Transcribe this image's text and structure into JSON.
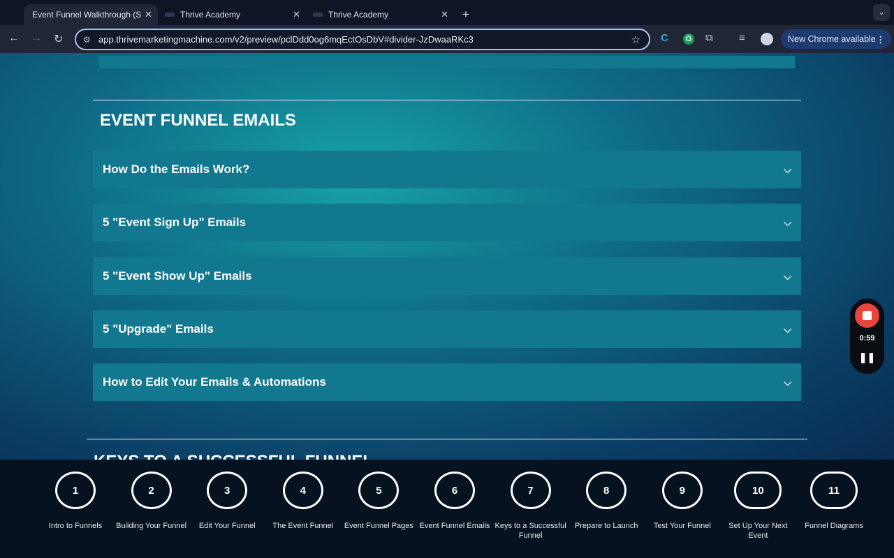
{
  "browser": {
    "tabs": [
      {
        "title": "Event Funnel Walkthrough (S",
        "active": true
      },
      {
        "title": "Thrive Academy"
      },
      {
        "title": "Thrive Academy"
      }
    ],
    "new_tab": "+",
    "url": "app.thrivemarketingmachine.com/v2/preview/pclDdd0og6mqEctOsDbV#divider-JzDwaaRKc3",
    "update_label": "New Chrome available"
  },
  "page": {
    "section_title": "EVENT FUNNEL EMAILS",
    "accordion": [
      {
        "label": "How Do the Emails Work?"
      },
      {
        "label": "5 \"Event Sign Up\" Emails"
      },
      {
        "label": "5 \"Event Show Up\" Emails"
      },
      {
        "label": "5 \"Upgrade\" Emails"
      },
      {
        "label": "How to Edit Your Emails & Automations"
      }
    ],
    "next_section_title": "KEYS TO A SUCCESSFUL FUNNEL"
  },
  "steps": [
    {
      "num": "1",
      "label": "Intro to Funnels"
    },
    {
      "num": "2",
      "label": "Building Your Funnel"
    },
    {
      "num": "3",
      "label": "Edit Your Funnel"
    },
    {
      "num": "4",
      "label": "The Event Funnel"
    },
    {
      "num": "5",
      "label": "Event Funnel Pages"
    },
    {
      "num": "6",
      "label": "Event Funnel Emails"
    },
    {
      "num": "7",
      "label": "Keys to a Successful Funnel"
    },
    {
      "num": "8",
      "label": "Prepare to Launch"
    },
    {
      "num": "9",
      "label": "Test Your Funnel"
    },
    {
      "num": "10",
      "label": "Set Up Your Next Event"
    },
    {
      "num": "11",
      "label": "Funnel Diagrams"
    }
  ],
  "recorder": {
    "time": "0:59",
    "stop_color": "#e8453c"
  }
}
